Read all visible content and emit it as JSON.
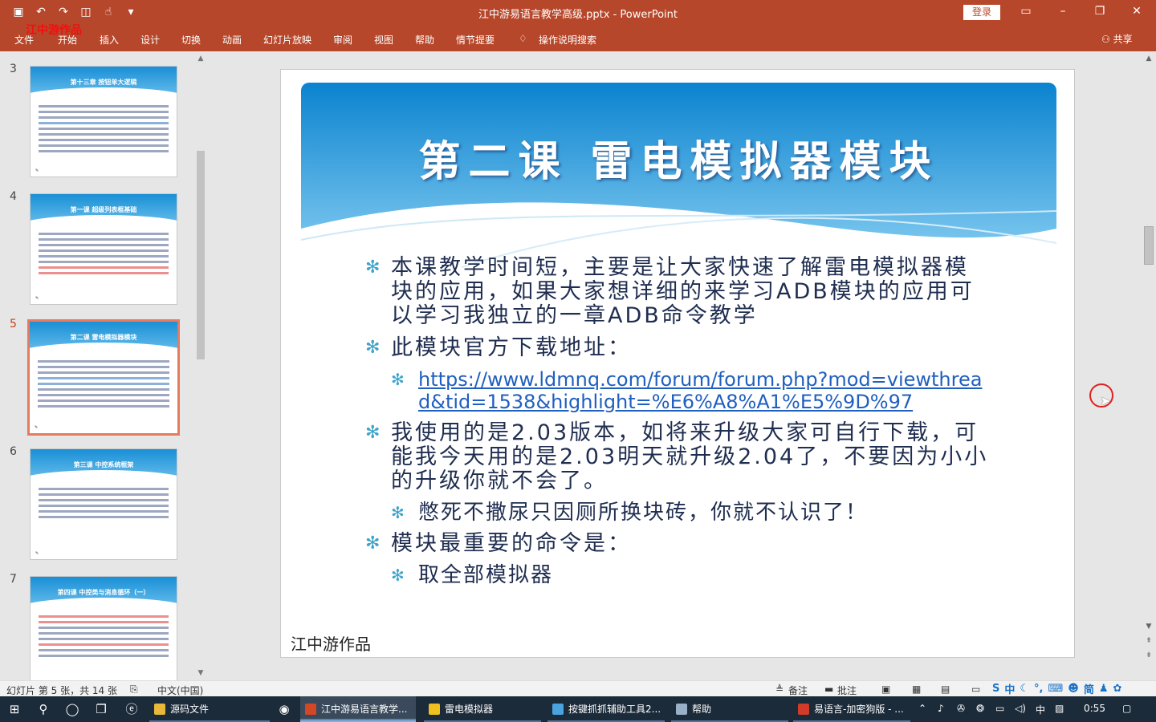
{
  "window": {
    "doc_title": "江中游易语言教学高级.pptx  -  PowerPoint",
    "login_label": "登录",
    "watermark": "江中游作品"
  },
  "ribbon": {
    "tabs": [
      "文件",
      "开始",
      "插入",
      "设计",
      "切换",
      "动画",
      "幻灯片放映",
      "审阅",
      "视图",
      "帮助",
      "情节提要"
    ],
    "search_label": "操作说明搜索",
    "share_label": "共享"
  },
  "thumbnails": [
    {
      "num": "3",
      "title": "第十三章 按钮单大逻辑"
    },
    {
      "num": "4",
      "title": "第一课 超级列表框基础"
    },
    {
      "num": "5",
      "title": "第二课 雷电模拟器模块"
    },
    {
      "num": "6",
      "title": "第三课 中控系统框架"
    },
    {
      "num": "7",
      "title": "第四课 中控类与消息循环（一）"
    }
  ],
  "slide": {
    "title": "第二课 雷电模拟器模块",
    "bullet1": "本课教学时间短，主要是让大家快速了解雷电模拟器模块的应用，如果大家想详细的来学习ADB模块的应用可以学习我独立的一章ADB命令教学",
    "bullet2": "此模块官方下载地址：",
    "link": "https://www.ldmnq.com/forum/forum.php?mod=viewthread&tid=1538&highlight=%E6%A8%A1%E5%9D%97",
    "bullet3": "我使用的是2.03版本，如将来升级大家可自行下载，可能我今天用的是2.03明天就升级2.04了，不要因为小小的升级你就不会了。",
    "sub3": "憋死不撒尿只因厕所换块砖，你就不认识了！",
    "bullet4": "模块最重要的命令是：",
    "sub4": "取全部模拟器",
    "signature": "江中游作品"
  },
  "statusbar": {
    "slide_info": "幻灯片 第 5 张，共 14 张",
    "language": "中文(中国)",
    "notes": "备注",
    "comments": "批注"
  },
  "taskbar": {
    "apps": [
      "源码文件",
      "江中游易语言教学...",
      "雷电模拟器",
      "按键抓抓辅助工具2...",
      "帮助",
      "易语言-加密狗版 - ..."
    ],
    "ime": "中",
    "clock": "0:55"
  },
  "colors": {
    "brand": "#b7472a",
    "slide_text": "#1f2d50",
    "bullet_star": "#3fa4c9",
    "link": "#1f5fbf"
  }
}
